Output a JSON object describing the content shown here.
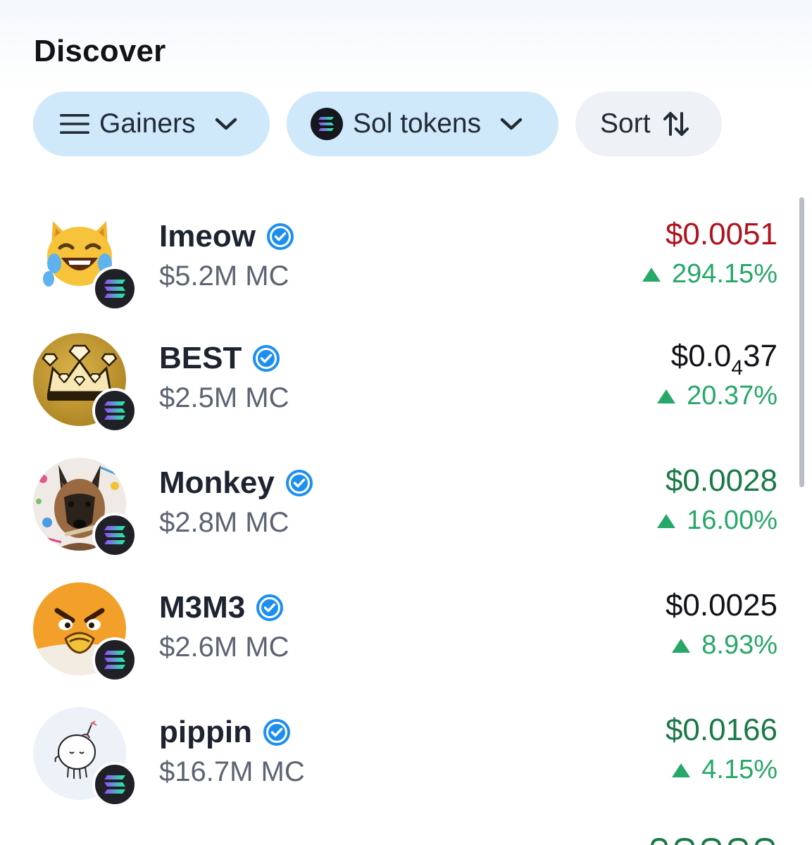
{
  "header": {
    "title": "Discover"
  },
  "filters": {
    "gainers_label": "Gainers",
    "sol_label": "Sol tokens",
    "sort_label": "Sort"
  },
  "colors": {
    "price_red": "#b0131d",
    "price_green": "#1a7a47",
    "price_black": "#111318",
    "change_green": "#27a768",
    "verified_blue": "#1d8ff0",
    "chip_blue": "#cfe9fb",
    "chip_gray": "#eef1f5"
  },
  "tokens": [
    {
      "name": "Imeow",
      "verified": true,
      "market_cap": "$5.2M MC",
      "price": "$0.0051",
      "price_color": "red",
      "change": "294.15%",
      "direction": "up",
      "avatar": "cat-tears-of-joy"
    },
    {
      "name": "BEST",
      "verified": true,
      "market_cap": "$2.5M MC",
      "price_prefix": "$0.0",
      "price_sub": "4",
      "price_suffix": "37",
      "price_color": "black",
      "change": "20.37%",
      "direction": "up",
      "avatar": "gold-crown"
    },
    {
      "name": "Monkey",
      "verified": true,
      "market_cap": "$2.8M MC",
      "price": "$0.0028",
      "price_color": "green",
      "change": "16.00%",
      "direction": "up",
      "avatar": "dog-photo"
    },
    {
      "name": "M3M3",
      "verified": true,
      "market_cap": "$2.6M MC",
      "price": "$0.0025",
      "price_color": "black",
      "change": "8.93%",
      "direction": "up",
      "avatar": "angry-orange-bird"
    },
    {
      "name": "pippin",
      "verified": true,
      "market_cap": "$16.7M MC",
      "price": "$0.0166",
      "price_color": "green",
      "change": "4.15%",
      "direction": "up",
      "avatar": "unicorn-doodle"
    }
  ],
  "icons": {
    "menu": "hamburger-icon",
    "chevron": "chevron-down-icon",
    "sort": "sort-arrows-icon",
    "chain": "solana-icon",
    "verified": "verified-badge-icon",
    "up": "triangle-up-icon"
  }
}
